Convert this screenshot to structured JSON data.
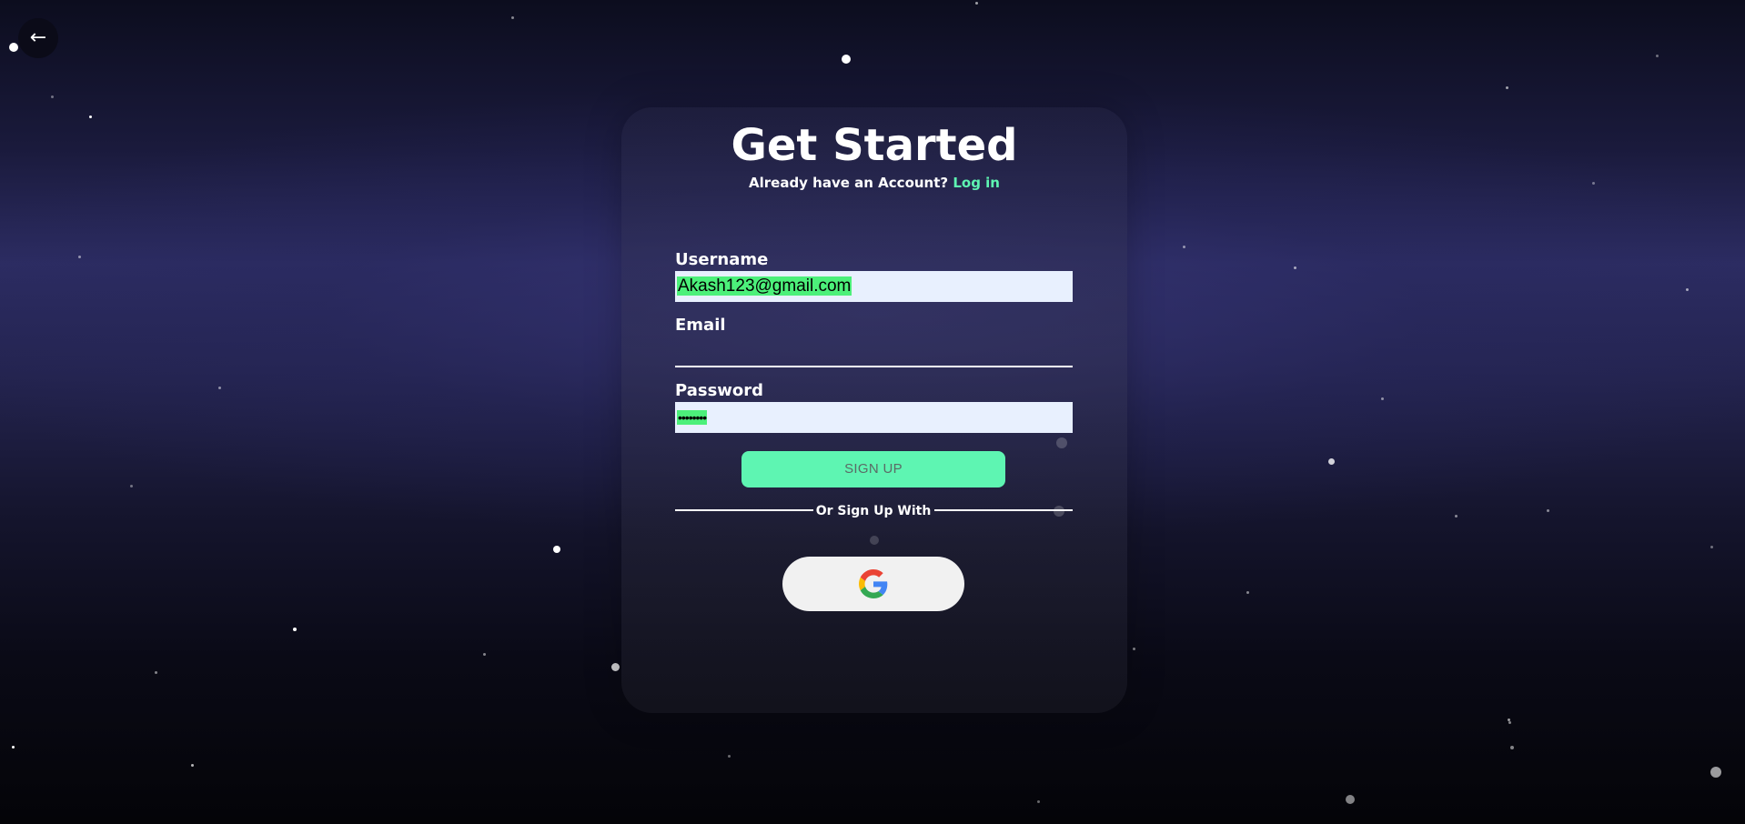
{
  "back_button": {
    "icon": "arrow-left-icon",
    "glyph": "←"
  },
  "header": {
    "title": "Get Started",
    "subtitle_text": "Already have an Account?",
    "login_link": "Log in"
  },
  "form": {
    "username": {
      "label": "Username",
      "value": "Akash123@gmail.com"
    },
    "email": {
      "label": "Email",
      "value": ""
    },
    "password": {
      "label": "Password",
      "value": "••••••••"
    },
    "submit_label": "SIGN UP",
    "divider_text": "Or Sign Up With",
    "social": {
      "provider_icon": "google-icon"
    }
  },
  "colors": {
    "accent": "#5ef5b2",
    "autofill_highlight": "#4cf07a",
    "input_background": "#e8f0fe"
  }
}
